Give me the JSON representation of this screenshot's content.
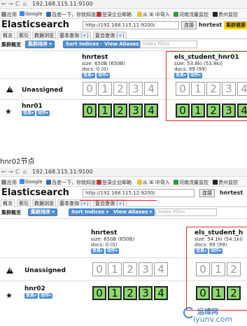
{
  "panels": [
    {
      "address": "192.168.115.11:9100",
      "bookmarks": [
        "应用",
        "Google",
        "百度一下，你就知道",
        "登录企业邮箱",
        "从 IE 中导入",
        "河南流量监控",
        "贵州监控"
      ],
      "app_title": "Elasticsearch",
      "connect_url": "http://192.168.115.11:9200/",
      "connect_label": "连接",
      "cluster_name": "hnrtest",
      "cluster_health": "集群健康",
      "tabs": [
        "概览",
        "索引",
        "数据浏览",
        "基本查询",
        "[+]",
        "复合查询",
        "[+]"
      ],
      "overview_label": "集群概览",
      "sort_button": "集群排序",
      "sort_indices": "Sort Indices",
      "view_aliases": "View Aliases",
      "index_filter": "Index Filter",
      "indices": [
        {
          "name": "hnrtest",
          "size": "size: 650B (650B)",
          "docs": "docs: 0 (0)",
          "info": "信息",
          "action": "动作"
        },
        {
          "name": "els_student_hnr01",
          "size": "size: 53.8ki (53.8ki)",
          "docs": "docs: 99 (99)",
          "info": "信息",
          "action": "动作"
        }
      ],
      "unassigned_label": "Unassigned",
      "node_name": "hnr01",
      "node_info": "信息",
      "node_action": "动作",
      "shards_unassigned_a": [
        "0",
        "1",
        "2",
        "3",
        "4"
      ],
      "shards_unassigned_b": [
        "0",
        "1",
        "2",
        "3",
        "4"
      ],
      "shards_node_a": [
        "0",
        "1",
        "2",
        "3",
        "4"
      ],
      "shards_node_b": [
        "0",
        "1",
        "2",
        "3",
        "4"
      ]
    },
    {
      "address": "192.168.115.11:9100",
      "bookmarks": [
        "应用",
        "Google",
        "百度一下，你就知道",
        "登录企业邮箱",
        "从 IE 中导入",
        "河南流量监控",
        "贵州监控"
      ],
      "app_title": "Elasticsearch",
      "connect_url": "http://192.168.115.12:9200/",
      "connect_label": "连接",
      "cluster_name": "hnrtest",
      "tabs": [
        "概览",
        "索引",
        "数据浏览",
        "基本查询",
        "[+]",
        "复合查询",
        "[+]"
      ],
      "overview_label": "集群概览",
      "sort_button": "集群排序",
      "sort_indices": "Sort Indices",
      "view_aliases": "View Aliases",
      "index_filter": "Index Filter",
      "indices": [
        {
          "name": "hnrtest",
          "size": "size: 650B (650B)",
          "docs": "docs: 0 (0)",
          "info": "信息",
          "action": "动作"
        },
        {
          "name": "els_student_h",
          "size": "size: 54.1ki (54.1ki)",
          "docs": "docs: 99 (99)",
          "info": "信息",
          "action": "动作"
        }
      ],
      "unassigned_label": "Unassigned",
      "node_name": "hnr02",
      "node_info": "信息",
      "node_action": "动作",
      "shards_unassigned_a": [
        "0",
        "1",
        "2",
        "3",
        "4"
      ],
      "shards_unassigned_b": [
        "0",
        "1",
        "2"
      ],
      "shards_node_a": [
        "0",
        "1",
        "2",
        "3",
        "4"
      ],
      "shards_node_b": [
        "0",
        "1",
        "2"
      ]
    }
  ],
  "caption": "hnr02节点",
  "watermark": {
    "line1": "运维网",
    "line2": "iyunv.com"
  },
  "colors": {
    "primary_shard": "#8dd86e",
    "button": "#4f8ed0",
    "health": "#ffd400",
    "highlight": "#e03030"
  }
}
